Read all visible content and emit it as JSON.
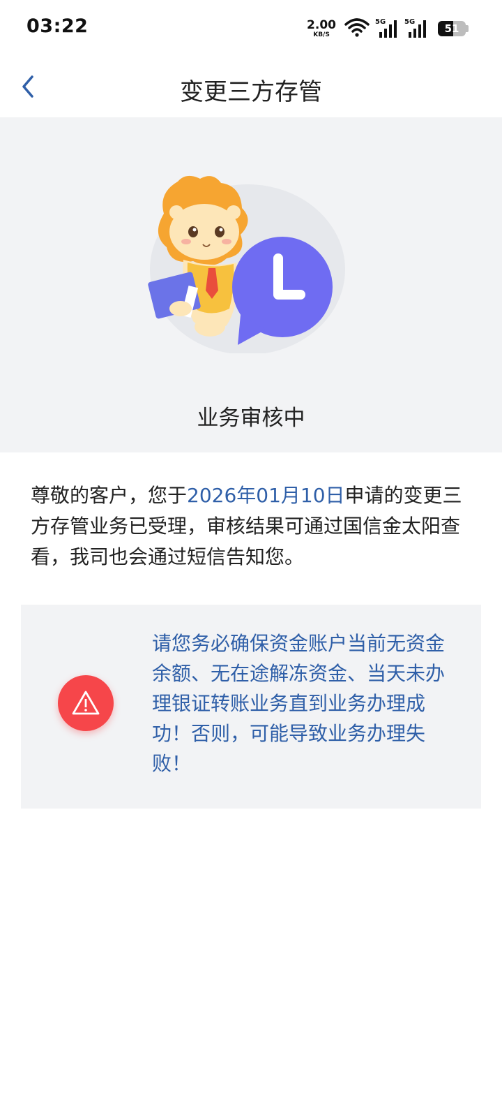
{
  "status_bar": {
    "time": "03:22",
    "net_speed": "2.00",
    "net_unit": "KB/S",
    "sim1_tag": "5G",
    "sim2_tag": "5G",
    "battery_percent": "51"
  },
  "header": {
    "title": "变更三方存管",
    "back_icon": "chevron-left-icon"
  },
  "status": {
    "text": "业务审核中",
    "illustration_icons": [
      "lion-mascot-icon",
      "clock-bubble-icon"
    ]
  },
  "message": {
    "prefix": "尊敬的客户，您于",
    "date": "2026年01月10日",
    "suffix": "申请的变更三方存管业务已受理，审核结果可通过国信金太阳查看，我司也会通过短信告知您。"
  },
  "warning": {
    "icon": "warning-icon",
    "text": "请您务必确保资金账户当前无资金余额、无在途解冻资金、当天未办理银证转账业务直到业务办理成功！否则，可能导致业务办理失败！"
  },
  "colors": {
    "accent_blue": "#2f5fa8",
    "panel_bg": "#f2f3f5",
    "warning_red": "#f6464a",
    "clock_purple": "#6f6cf2"
  }
}
